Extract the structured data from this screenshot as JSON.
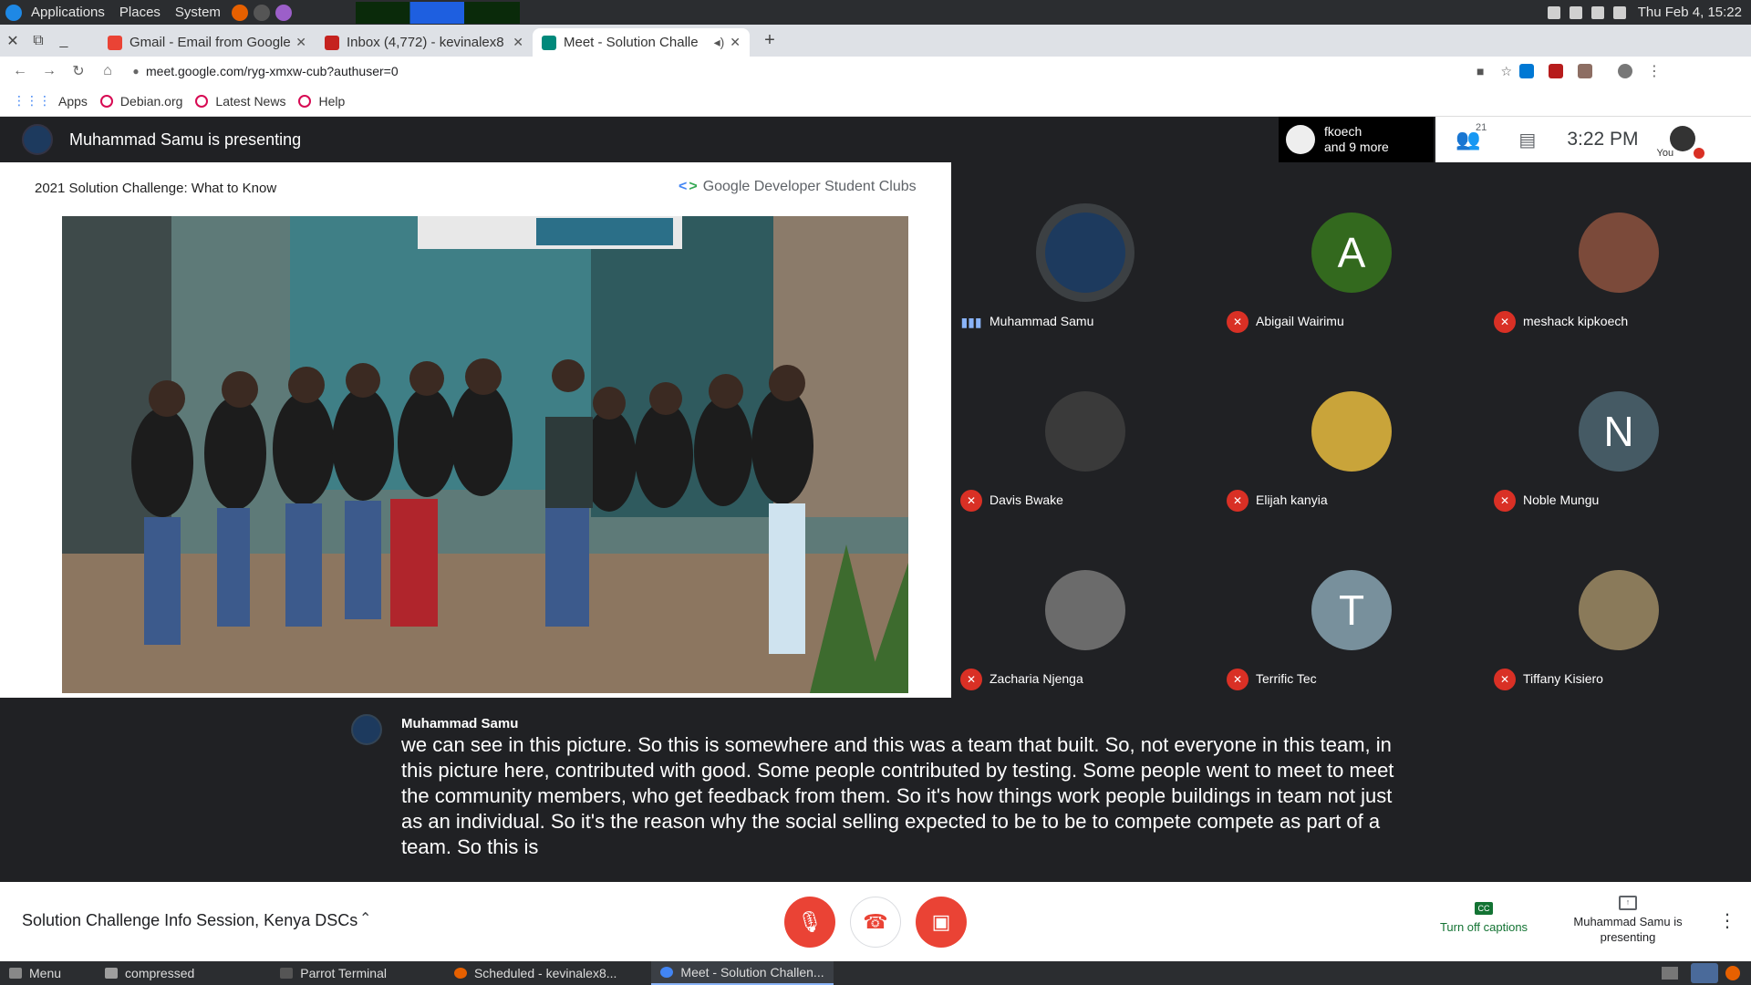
{
  "os_panel": {
    "menus": [
      "Applications",
      "Places",
      "System"
    ],
    "datetime": "Thu Feb 4, 15:22"
  },
  "browser": {
    "tabs": [
      {
        "title": "Gmail - Email from Google",
        "icon": "gmail-icon",
        "active": false
      },
      {
        "title": "Inbox (4,772) - kevinalex8",
        "icon": "gmail-inbox-icon",
        "active": false
      },
      {
        "title": "Meet - Solution Challe",
        "icon": "meet-icon",
        "active": true
      }
    ],
    "url": "meet.google.com/ryg-xmxw-cub?authuser=0",
    "bookmarks": [
      "Apps",
      "Debian.org",
      "Latest News",
      "Help"
    ]
  },
  "meet": {
    "presenting_title": "Muhammad Samu is presenting",
    "participants_chip": {
      "line1": "fkoech",
      "line2": "and 9 more"
    },
    "people_count": "21",
    "clock": "3:22 PM",
    "self_label": "You",
    "slide": {
      "title": "2021 Solution Challenge: What to Know",
      "logo_text": "Google Developer Student Clubs"
    },
    "participants": [
      {
        "name": "Muhammad Samu",
        "initial": "",
        "color": "#1d3a5e",
        "speaking": true
      },
      {
        "name": "Abigail Wairimu",
        "initial": "A",
        "color": "#33691e",
        "speaking": false
      },
      {
        "name": "meshack kipkoech",
        "initial": "",
        "color": "#7b4a3a",
        "speaking": false
      },
      {
        "name": "Davis Bwake",
        "initial": "",
        "color": "#3a3a3a",
        "speaking": false
      },
      {
        "name": "Elijah kanyia",
        "initial": "",
        "color": "#c9a43a",
        "speaking": false
      },
      {
        "name": "Noble Mungu",
        "initial": "N",
        "color": "#455a64",
        "speaking": false
      },
      {
        "name": "Zacharia Njenga",
        "initial": "",
        "color": "#6b6b6b",
        "speaking": false
      },
      {
        "name": "Terrific Tec",
        "initial": "T",
        "color": "#78909c",
        "speaking": false
      },
      {
        "name": "Tiffany Kisiero",
        "initial": "",
        "color": "#8a7a5a",
        "speaking": false
      }
    ],
    "caption": {
      "speaker": "Muhammad Samu",
      "text": "we can see in this picture. So this is somewhere and this was a team that built. So, not everyone in this team, in this picture here, contributed with good. Some people contributed by testing. Some people went to meet to meet the community members, who get feedback from them. So it's how things work people buildings in team not just as an individual. So it's the reason why the social selling expected to be to be to compete compete as part of a team. So this is"
    },
    "meeting_title": "Solution Challenge Info Session, Kenya DSCs",
    "captions_button": "Turn off captions",
    "present_button": "Muhammad Samu is presenting",
    "mic_state": "muted",
    "camera_state": "off"
  },
  "taskbar": {
    "items": [
      "Menu",
      "compressed",
      "Parrot Terminal",
      "Scheduled - kevinalex8...",
      "Meet - Solution Challen..."
    ]
  }
}
